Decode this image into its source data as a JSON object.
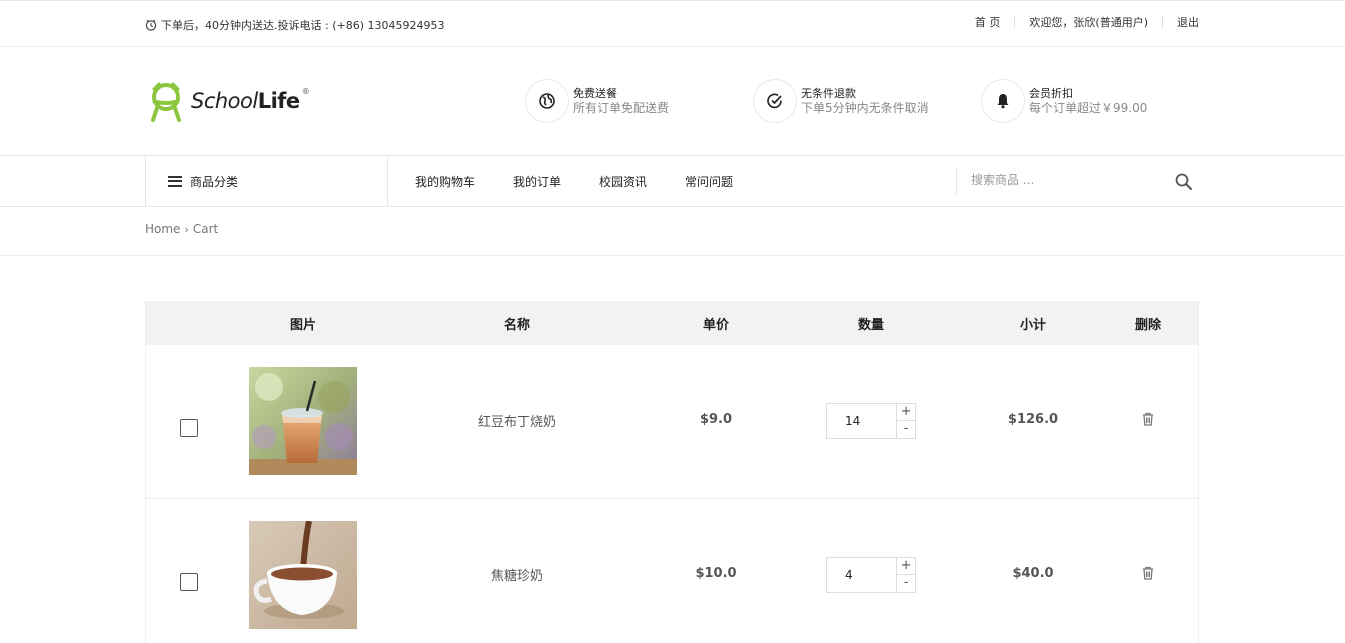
{
  "topbar": {
    "notice": "下单后，40分钟内送达.投诉电话 : (+86) 13045924953",
    "links": [
      "首 页",
      "欢迎您，张欣(普通用户)",
      "退出"
    ]
  },
  "logo": {
    "school": "School",
    "life": "Life",
    "reg": "®"
  },
  "features": [
    {
      "icon": "globe-icon",
      "title": "免费送餐",
      "sub": "所有订单免配送费"
    },
    {
      "icon": "check-circle-icon",
      "title": "无条件退款",
      "sub": "下单5分钟内无条件取消"
    },
    {
      "icon": "bell-icon",
      "title": "会员折扣",
      "sub": "每个订单超过￥99.00"
    }
  ],
  "nav": {
    "category": "商品分类",
    "menu": [
      "我的购物车",
      "我的订单",
      "校园资讯",
      "常问问题"
    ],
    "search_placeholder": "搜索商品 ..."
  },
  "breadcrumb": {
    "home": "Home",
    "chevron": "›",
    "current": "Cart"
  },
  "cart": {
    "headers": [
      "图片",
      "名称",
      "单价",
      "数量",
      "小计",
      "删除"
    ],
    "rows": [
      {
        "name": "红豆布丁烧奶",
        "price": "$9.0",
        "qty": "14",
        "subtotal": "$126.0",
        "checked": false
      },
      {
        "name": "焦糖珍奶",
        "price": "$10.0",
        "qty": "4",
        "subtotal": "$40.0",
        "checked": false
      }
    ],
    "plus": "+",
    "minus": "-"
  }
}
